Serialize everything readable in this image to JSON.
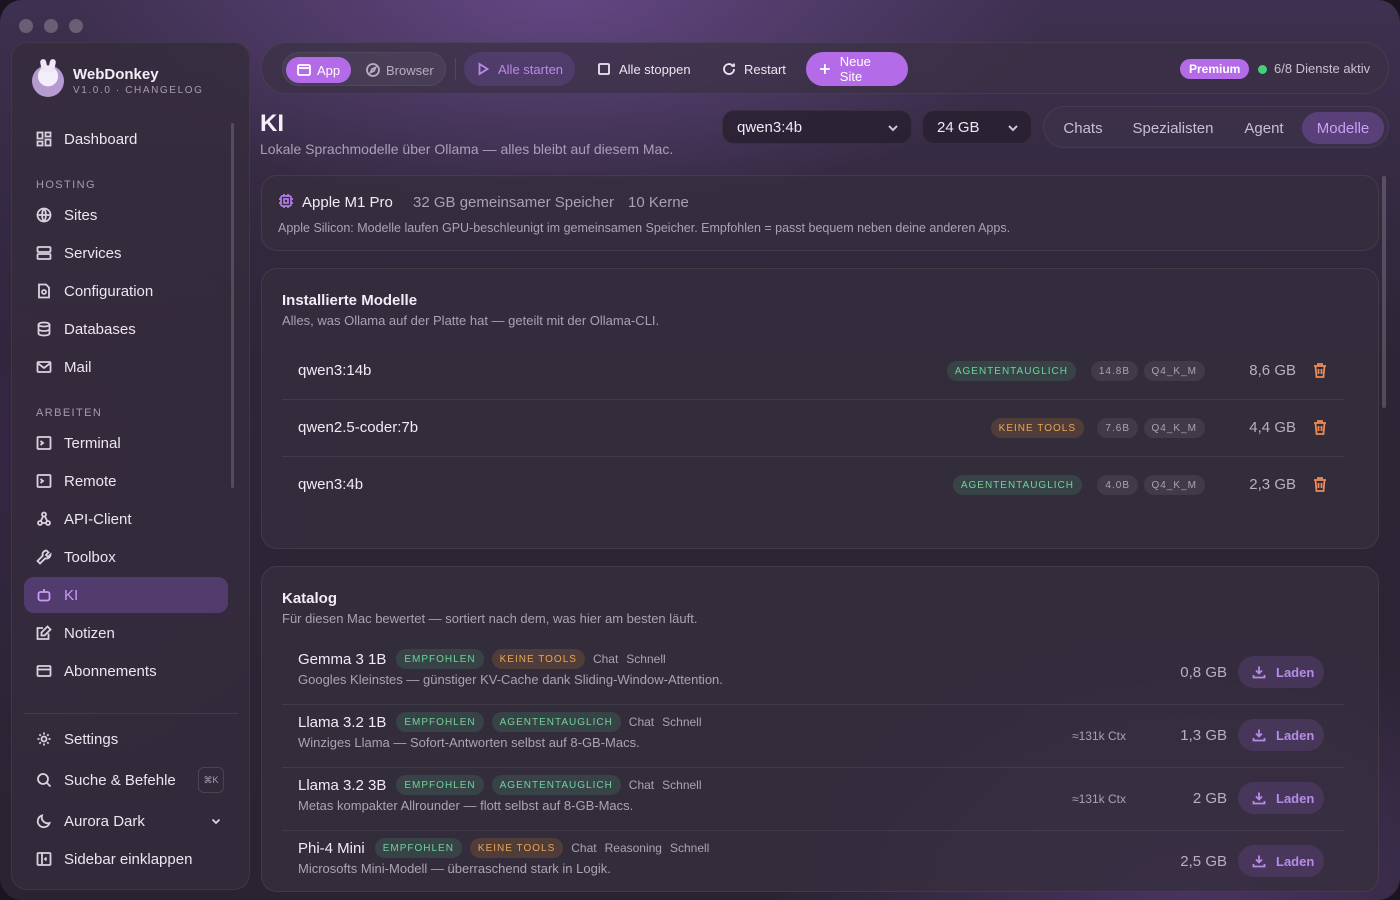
{
  "app": {
    "name": "WebDonkey",
    "version": "V1.0.0 · CHANGELOG"
  },
  "sidebar": {
    "dashboard": "Dashboard",
    "sections": {
      "hosting": "HOSTING",
      "arbeiten": "ARBEITEN"
    },
    "hosting_items": [
      "Sites",
      "Services",
      "Configuration",
      "Databases",
      "Mail"
    ],
    "arbeiten_items": [
      "Terminal",
      "Remote",
      "API-Client",
      "Toolbox",
      "KI",
      "Notizen",
      "Abonnements"
    ],
    "active_item": "KI",
    "bottom": {
      "settings": "Settings",
      "search": "Suche & Befehle",
      "search_shortcut": "⌘K",
      "theme": "Aurora Dark",
      "collapse": "Sidebar einklappen"
    }
  },
  "toolbar": {
    "mode_app": "App",
    "mode_browser": "Browser",
    "start_all": "Alle starten",
    "stop_all": "Alle stoppen",
    "restart": "Restart",
    "new_site": "Neue Site",
    "premium": "Premium",
    "services_status": "6/8 Dienste aktiv",
    "status_color": "#44d07a"
  },
  "page": {
    "title": "KI",
    "subtitle": "Lokale Sprachmodelle über Ollama — alles bleibt auf diesem Mac.",
    "model_select": "qwen3:4b",
    "ram_select": "24 GB",
    "tabs": [
      "Chats",
      "Spezialisten",
      "Agent",
      "Modelle"
    ],
    "active_tab": "Modelle"
  },
  "hardware": {
    "chip": "Apple M1 Pro",
    "memory": "32 GB gemeinsamer Speicher",
    "cores": "10 Kerne",
    "note": "Apple Silicon: Modelle laufen GPU-beschleunigt im gemeinsamen Speicher. Empfohlen = passt bequem neben deine anderen Apps."
  },
  "installed": {
    "title": "Installierte Modelle",
    "subtitle": "Alles, was Ollama auf der Platte hat — geteilt mit der Ollama-CLI.",
    "rows": [
      {
        "name": "qwen3:14b",
        "capability": "AGENTENTAUGLICH",
        "cap_type": "green",
        "params": "14.8B",
        "quant": "Q4_K_M",
        "size": "8,6 GB"
      },
      {
        "name": "qwen2.5-coder:7b",
        "capability": "KEINE TOOLS",
        "cap_type": "orange",
        "params": "7.6B",
        "quant": "Q4_K_M",
        "size": "4,4 GB"
      },
      {
        "name": "qwen3:4b",
        "capability": "AGENTENTAUGLICH",
        "cap_type": "green",
        "params": "4.0B",
        "quant": "Q4_K_M",
        "size": "2,3 GB"
      }
    ]
  },
  "catalog": {
    "title": "Katalog",
    "subtitle": "Für diesen Mac bewertet — sortiert nach dem, was hier am besten läuft.",
    "load_label": "Laden",
    "rows": [
      {
        "name": "Gemma 3 1B",
        "recommended": "EMPFOHLEN",
        "capability": "KEINE TOOLS",
        "cap_type": "orange",
        "tags": [
          "Chat",
          "Schnell"
        ],
        "description": "Googles Kleinstes — günstiger KV-Cache dank Sliding-Window-Attention.",
        "context": "",
        "size": "0,8 GB"
      },
      {
        "name": "Llama 3.2 1B",
        "recommended": "EMPFOHLEN",
        "capability": "AGENTENTAUGLICH",
        "cap_type": "green",
        "tags": [
          "Chat",
          "Schnell"
        ],
        "description": "Winziges Llama — Sofort-Antworten selbst auf 8-GB-Macs.",
        "context": "≈131k Ctx",
        "size": "1,3 GB"
      },
      {
        "name": "Llama 3.2 3B",
        "recommended": "EMPFOHLEN",
        "capability": "AGENTENTAUGLICH",
        "cap_type": "green",
        "tags": [
          "Chat",
          "Schnell"
        ],
        "description": "Metas kompakter Allrounder — flott selbst auf 8-GB-Macs.",
        "context": "≈131k Ctx",
        "size": "2 GB"
      },
      {
        "name": "Phi-4 Mini",
        "recommended": "EMPFOHLEN",
        "capability": "KEINE TOOLS",
        "cap_type": "orange",
        "tags": [
          "Chat",
          "Reasoning",
          "Schnell"
        ],
        "description": "Microsofts Mini-Modell — überraschend stark in Logik.",
        "context": "",
        "size": "2,5 GB"
      }
    ]
  },
  "colors": {
    "accent": "#b36be8",
    "green_badge": "#6fd39a",
    "orange_badge": "#eba556",
    "trash": "#ee8a58"
  }
}
